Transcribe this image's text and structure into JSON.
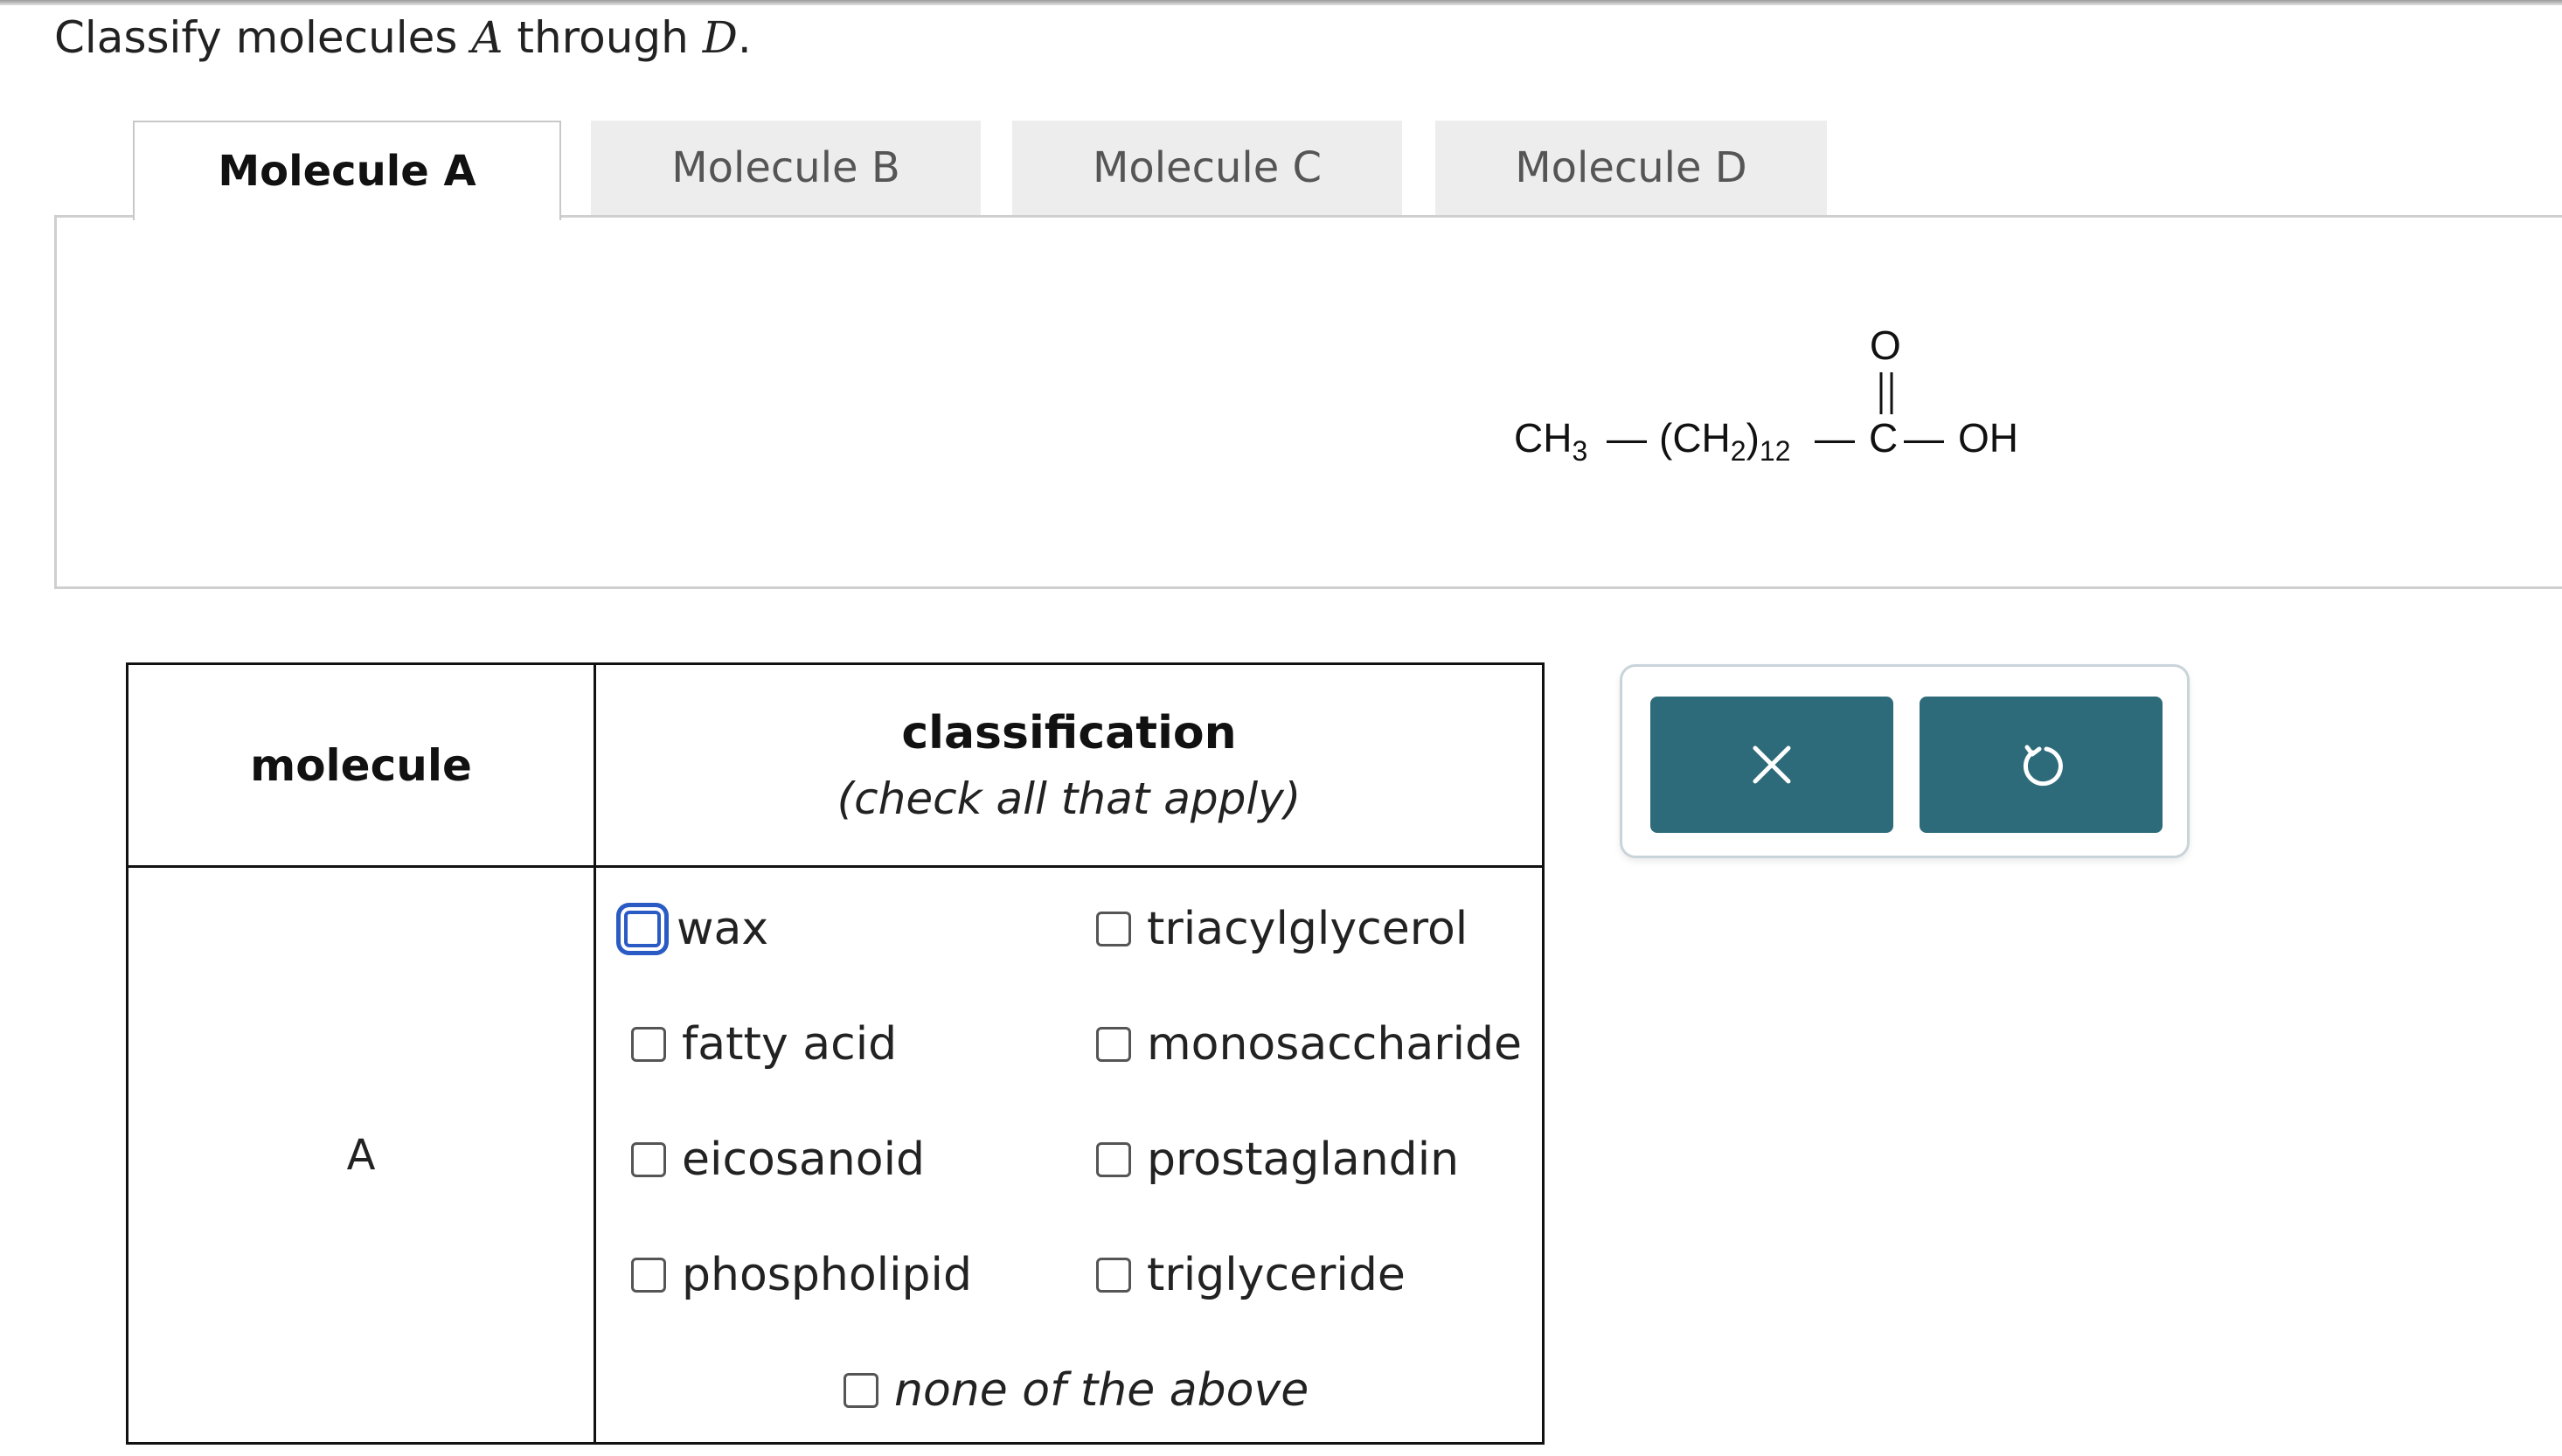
{
  "prompt": {
    "prefix": "Classify molecules ",
    "var_a": "A",
    "middle": " through ",
    "var_d": "D",
    "suffix": "."
  },
  "tabs": [
    {
      "label": "Molecule A",
      "active": true
    },
    {
      "label": "Molecule B",
      "active": false
    },
    {
      "label": "Molecule C",
      "active": false
    },
    {
      "label": "Molecule D",
      "active": false
    }
  ],
  "structure": {
    "ch3": "CH",
    "ch3_sub": "3",
    "ch2_open": "(CH",
    "ch2_sub": "2",
    "ch2_close": ")",
    "repeat": "12",
    "carbonyl_o": "O",
    "carbon": "C",
    "hydroxyl": "OH"
  },
  "table": {
    "col_molecule": "molecule",
    "col_classification": "classification",
    "col_classification_note": "(check all that apply)",
    "row_label": "A",
    "options_left": [
      "wax",
      "fatty acid",
      "eicosanoid",
      "phospholipid"
    ],
    "options_right": [
      "triacylglycerol",
      "monosaccharide",
      "prostaglandin",
      "triglyceride"
    ],
    "option_none": "none of the above"
  },
  "actions": {
    "clear_icon": "close-x-icon",
    "reset_icon": "undo-icon",
    "color": "#2e6b7a"
  }
}
